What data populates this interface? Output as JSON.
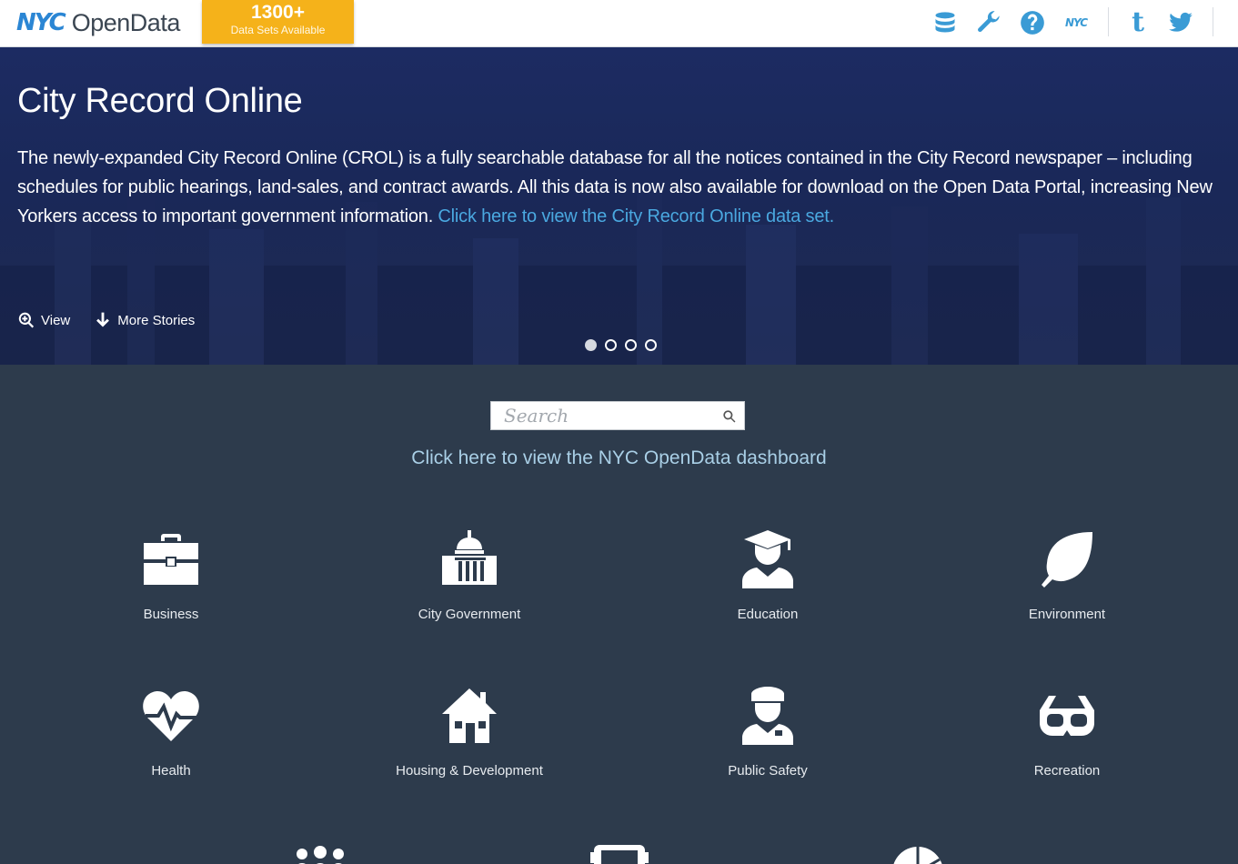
{
  "header": {
    "logo_nyc": "NYC",
    "logo_open": "OpenData",
    "badge_count": "1300+",
    "badge_sub": "Data Sets Available",
    "icons": [
      "database-icon",
      "wrench-icon",
      "help-icon",
      "nyc-icon",
      "tumblr-icon",
      "twitter-icon"
    ],
    "nyc_icon_text": "NYC",
    "tumblr_text": "t"
  },
  "hero": {
    "title": "City Record Online",
    "body": "The newly-expanded City Record Online (CROL) is a fully searchable database for all the notices contained in the City Record newspaper – including schedules for public hearings, land-sales, and contract awards. All this data is now also available for download on the Open Data Portal, increasing New Yorkers access to important government information.",
    "link": "Click here to view the City Record Online data set.",
    "view_label": "View",
    "more_label": "More Stories",
    "slides_total": 4,
    "slide_active": 1
  },
  "main": {
    "search_placeholder": "Search",
    "dashboard_link": "Click here to view the NYC OpenData dashboard",
    "categories": [
      {
        "label": "Business",
        "icon": "briefcase-icon"
      },
      {
        "label": "City Government",
        "icon": "capitol-icon"
      },
      {
        "label": "Education",
        "icon": "graduate-icon"
      },
      {
        "label": "Environment",
        "icon": "leaf-icon"
      },
      {
        "label": "Health",
        "icon": "heart-pulse-icon"
      },
      {
        "label": "Housing & Development",
        "icon": "house-icon"
      },
      {
        "label": "Public Safety",
        "icon": "police-icon"
      },
      {
        "label": "Recreation",
        "icon": "goggles-icon"
      }
    ]
  },
  "colors": {
    "brand_blue": "#3a9bd5",
    "badge_orange": "#f5b21a",
    "hero_bg": "#1c2b62",
    "main_bg": "#2d3b4c",
    "link": "#4aa8e0"
  }
}
